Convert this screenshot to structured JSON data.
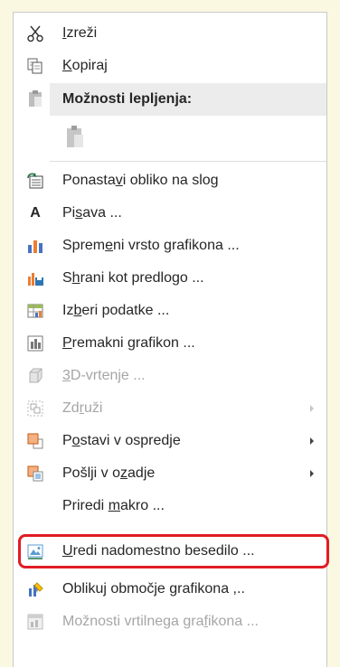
{
  "menu": {
    "cut": {
      "pre": "",
      "u": "I",
      "post": "zreži"
    },
    "copy": {
      "pre": "",
      "u": "K",
      "post": "opiraj"
    },
    "paste_header": "Možnosti lepljenja:",
    "reset_style": {
      "pre": "Ponasta",
      "u": "v",
      "post": "i obliko na slog"
    },
    "font": {
      "icon_letter": "A",
      "pre": "Pi",
      "u": "s",
      "post": "ava ..."
    },
    "change_chart_type": {
      "pre": "Sprem",
      "u": "e",
      "post": "ni vrsto grafikona ..."
    },
    "save_template": {
      "pre": "S",
      "u": "h",
      "post": "rani kot predlogo ..."
    },
    "select_data": {
      "pre": "Iz",
      "u": "b",
      "post": "eri podatke ..."
    },
    "move_chart": {
      "pre": "",
      "u": "P",
      "post": "remakni grafikon ..."
    },
    "rotation_3d": {
      "pre": "",
      "u": "3",
      "post": "D-vrtenje ..."
    },
    "group": {
      "pre": "Zd",
      "u": "r",
      "post": "uži"
    },
    "bring_front": {
      "pre": "P",
      "u": "o",
      "post": "stavi v ospredje"
    },
    "send_back": {
      "pre": "Pošlji v o",
      "u": "z",
      "post": "adje"
    },
    "assign_macro": {
      "pre": "Priredi ",
      "u": "m",
      "post": "akro ..."
    },
    "edit_alt_text": {
      "pre": "",
      "u": "U",
      "post": "redi nadomestno besedilo ..."
    },
    "format_chart_area": {
      "pre": "Oblikuj območje grafikona ",
      "u": ",",
      "post": ".."
    },
    "pivot_options": {
      "pre": "Možnosti vrtilnega gra",
      "u": "f",
      "post": "ikona ..."
    }
  },
  "colors": {
    "highlight": "#e11c24",
    "accent": "#217346"
  }
}
